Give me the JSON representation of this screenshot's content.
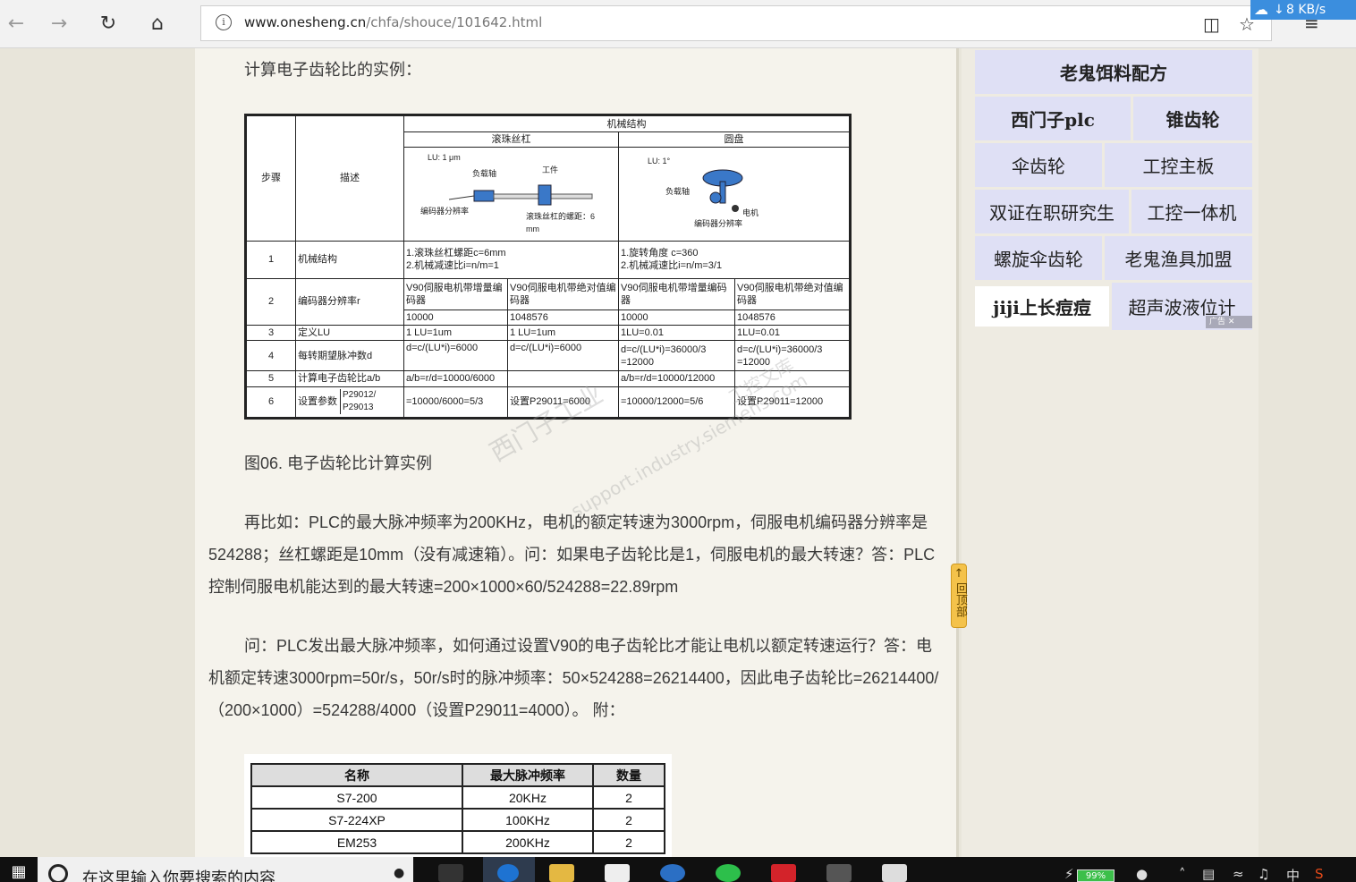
{
  "browser": {
    "url_host": "www.onesheng.cn",
    "url_path": "/chfa/shouce/101642.html",
    "download_speed": "8 KB/s"
  },
  "article": {
    "intro": "计算电子齿轮比的实例：",
    "figure_caption": "图06. 电子齿轮比计算实例",
    "paragraph1": "再比如：PLC的最大脉冲频率为200KHz，电机的额定转速为3000rpm，伺服电机编码器分辨率是524288；丝杠螺距是10mm（没有减速箱）。问：如果电子齿轮比是1，伺服电机的最大转速？答：PLC 控制伺服电机能达到的最大转速=200×1000×60/524288=22.89rpm",
    "paragraph2": "问：PLC发出最大脉冲频率，如何通过设置V90的电子齿轮比才能让电机以额定转速运行？答：电机额定转速3000rpm=50r/s，50r/s时的脉冲频率：50×524288=26214400，因此电子齿轮比=26214400/（200×1000）=524288/4000（设置P29011=4000）。 附："
  },
  "figure": {
    "h_step": "步骤",
    "h_desc": "描述",
    "h_mech": "机械结构",
    "h_ballscrew": "滚珠丝杠",
    "h_disc": "圆盘",
    "diag_lu1": "LU: 1 μm",
    "diag_load": "负载轴",
    "diag_work": "工件",
    "diag_enc": "编码器分辨率",
    "diag_pitch": "滚珠丝杠的螺距：6 mm",
    "diag_lu2": "LU: 1°",
    "diag_load2": "负载轴",
    "diag_motor": "电机",
    "diag_enc2": "编码器分辨率",
    "rows": [
      {
        "n": "1",
        "desc": "机械结构",
        "a": "1.滚珠丝杠螺距c=6mm\n2.机械减速比i=n/m=1",
        "b": "1.旋转角度 c=360\n2.机械减速比i=n/m=3/1"
      },
      {
        "n": "2",
        "desc": "编码器分辨率r",
        "a1": "V90伺服电机带增量编码器",
        "a2": "V90伺服电机带绝对值编码器",
        "b1": "V90伺服电机带增量编码器",
        "b2": "V90伺服电机带绝对值编码器",
        "a1v": "10000",
        "a2v": "1048576",
        "b1v": "10000",
        "b2v": "1048576"
      },
      {
        "n": "3",
        "desc": "定义LU",
        "a1": "1 LU=1um",
        "a2": "1 LU=1um",
        "b1": "1LU=0.01",
        "b2": "1LU=0.01"
      },
      {
        "n": "4",
        "desc": "每转期望脉冲数d",
        "a1": "d=c/(LU*i)=6000",
        "a2": "d=c/(LU*i)=6000",
        "b1": "d=c/(LU*i)=36000/3\n=12000",
        "b2": "d=c/(LU*i)=36000/3\n=12000"
      },
      {
        "n": "5",
        "desc": "计算电子齿轮比a/b",
        "a1": "a/b=r/d=10000/6000",
        "a2": "",
        "b1": "a/b=r/d=10000/12000",
        "b2": ""
      },
      {
        "n": "6",
        "desc": "设置参数",
        "param": "P29012/\nP29013",
        "a1": "=10000/6000=5/3",
        "a2": "设置P29011=6000",
        "b1": "=10000/12000=5/6",
        "b2": "设置P29011=12000"
      }
    ],
    "watermark1": "西门子工业",
    "watermark2": "support.industry.siemens.com",
    "watermark3": "工控文库"
  },
  "table2": {
    "headers": [
      "名称",
      "最大脉冲频率",
      "数量"
    ],
    "rows": [
      [
        "S7-200",
        "20KHz",
        "2"
      ],
      [
        "S7-224XP",
        "100KHz",
        "2"
      ],
      [
        "EM253",
        "200KHz",
        "2"
      ]
    ]
  },
  "back_to_top": "回顶部",
  "sidebar_ads": {
    "title": "老鬼饵料配方",
    "items": [
      "西门子plc",
      "锥齿轮",
      "伞齿轮",
      "工控主板",
      "双证在职研究生",
      "工控一体机",
      "螺旋伞齿轮",
      "老鬼渔具加盟",
      "jiji上长痘痘",
      "超声波液位计"
    ],
    "badge": "广告"
  },
  "taskbar": {
    "search_placeholder": "在这里输入你要搜索的内容",
    "battery": "99%",
    "ime": "中"
  }
}
